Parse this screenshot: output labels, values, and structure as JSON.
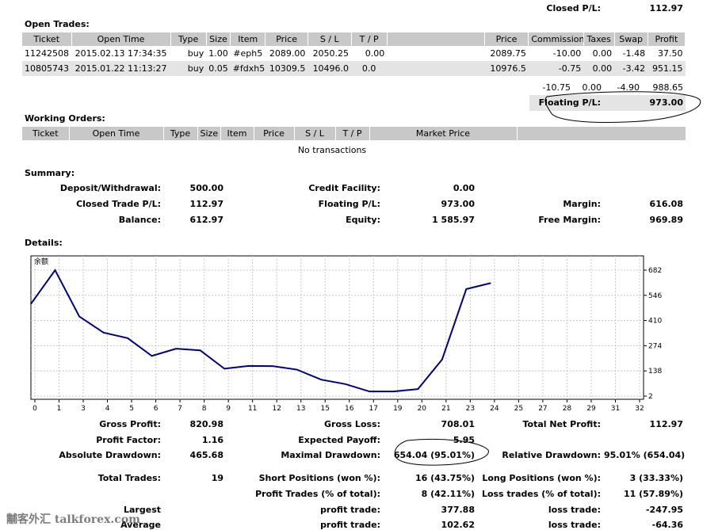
{
  "closed_pl": {
    "label": "Closed P/L:",
    "value": "112.97"
  },
  "open_trades": {
    "title": "Open Trades:",
    "headers": [
      "Ticket",
      "Open Time",
      "Type",
      "Size",
      "Item",
      "Price",
      "S / L",
      "T / P",
      "",
      "Price",
      "Commission",
      "Taxes",
      "Swap",
      "Profit"
    ],
    "rows": [
      [
        "11242508",
        "2015.02.13 17:34:35",
        "buy",
        "1.00",
        "#eph5",
        "2089.00",
        "2050.25",
        "0.00",
        "",
        "2089.75",
        "-10.00",
        "0.00",
        "-1.48",
        "37.50"
      ],
      [
        "10805743",
        "2015.01.22 11:13:27",
        "buy",
        "0.05",
        "#fdxh5",
        "10309.5",
        "10496.0",
        "0.0",
        "",
        "10976.5",
        "-0.75",
        "0.00",
        "-3.42",
        "951.15"
      ]
    ],
    "totals": {
      "commission": "-10.75",
      "taxes": "0.00",
      "swap": "-4.90",
      "profit": "988.65"
    },
    "floating_pl": {
      "label": "Floating P/L:",
      "value": "973.00"
    }
  },
  "working_orders": {
    "title": "Working Orders:",
    "headers": [
      "Ticket",
      "Open Time",
      "Type",
      "Size",
      "Item",
      "Price",
      "S / L",
      "T / P",
      "Market Price",
      ""
    ],
    "empty_text": "No transactions"
  },
  "summary": {
    "title": "Summary:",
    "deposit": {
      "label": "Deposit/Withdrawal:",
      "value": "500.00"
    },
    "credit": {
      "label": "Credit Facility:",
      "value": "0.00"
    },
    "closed_trade_pl": {
      "label": "Closed Trade P/L:",
      "value": "112.97"
    },
    "floating_pl": {
      "label": "Floating P/L:",
      "value": "973.00"
    },
    "margin": {
      "label": "Margin:",
      "value": "616.08"
    },
    "balance": {
      "label": "Balance:",
      "value": "612.97"
    },
    "equity": {
      "label": "Equity:",
      "value": "1 585.97"
    },
    "free_margin": {
      "label": "Free Margin:",
      "value": "969.89"
    }
  },
  "details": {
    "title": "Details:"
  },
  "chart_data": {
    "type": "line",
    "title": "余额",
    "x": [
      0,
      1,
      2,
      3,
      4,
      5,
      6,
      7,
      8,
      9,
      10,
      11,
      12,
      13,
      14,
      15,
      16,
      17,
      18,
      19
    ],
    "values": [
      500,
      682,
      432,
      345,
      315,
      219,
      258,
      249,
      150,
      165,
      164,
      145,
      91,
      67,
      27,
      27,
      40,
      200,
      580,
      612
    ],
    "xticks": [
      0,
      1,
      3,
      4,
      5,
      6,
      7,
      8,
      9,
      11,
      12,
      13,
      15,
      16,
      17,
      19,
      20,
      21,
      23,
      24,
      25,
      27,
      28,
      29,
      31,
      32
    ],
    "yticks": [
      682,
      546,
      410,
      274,
      138,
      2
    ],
    "ylim": [
      2,
      682
    ],
    "line_color": "#000080",
    "grid": true
  },
  "stats": {
    "gross_profit": {
      "label": "Gross Profit:",
      "value": "820.98"
    },
    "gross_loss": {
      "label": "Gross Loss:",
      "value": "708.01"
    },
    "total_net_profit": {
      "label": "Total Net Profit:",
      "value": "112.97"
    },
    "profit_factor": {
      "label": "Profit Factor:",
      "value": "1.16"
    },
    "expected_payoff": {
      "label": "Expected Payoff:",
      "value": "5.95"
    },
    "absolute_drawdown": {
      "label": "Absolute Drawdown:",
      "value": "465.68"
    },
    "maximal_drawdown": {
      "label": "Maximal Drawdown:",
      "value": "654.04 (95.01%)"
    },
    "relative_drawdown": {
      "label": "Relative Drawdown:",
      "value": "95.01% (654.04)"
    },
    "total_trades": {
      "label": "Total Trades:",
      "value": "19"
    },
    "short_positions": {
      "label": "Short Positions (won %):",
      "value": "16 (43.75%)"
    },
    "long_positions": {
      "label": "Long Positions (won %):",
      "value": "3 (33.33%)"
    },
    "profit_trades": {
      "label": "Profit Trades (% of total):",
      "value": "8 (42.11%)"
    },
    "loss_trades": {
      "label": "Loss trades (% of total):",
      "value": "11 (57.89%)"
    },
    "largest": {
      "label": "Largest",
      "profit_label": "profit trade:",
      "profit_value": "377.88",
      "loss_label": "loss trade:",
      "loss_value": "-247.95"
    },
    "average": {
      "label": "Average",
      "profit_label": "profit trade:",
      "profit_value": "102.62",
      "loss_label": "loss trade:",
      "loss_value": "-64.36"
    }
  },
  "watermark": "黼客外汇 talkforex.com"
}
